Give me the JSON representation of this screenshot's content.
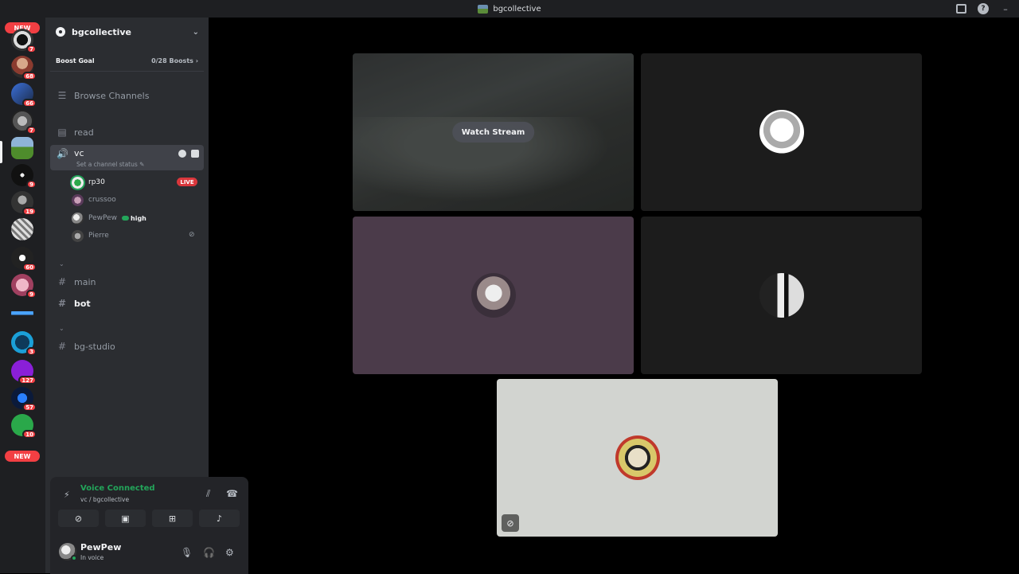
{
  "window": {
    "title": "bgcollective"
  },
  "rail": {
    "new_label_top": "NEW",
    "new_label_bottom": "NEW",
    "servers": [
      {
        "badge": "7"
      },
      {
        "badge": "68"
      },
      {
        "badge": "66"
      },
      {
        "badge": "7"
      },
      {
        "badge": ""
      },
      {
        "badge": "9"
      },
      {
        "badge": "19"
      },
      {
        "badge": ""
      },
      {
        "badge": "60"
      },
      {
        "badge": "9"
      },
      {
        "badge": ""
      },
      {
        "badge": "3"
      },
      {
        "badge": "127"
      },
      {
        "badge": "57"
      },
      {
        "badge": "10"
      }
    ]
  },
  "guild": {
    "name": "bgcollective"
  },
  "boost": {
    "label": "Boost Goal",
    "count": "0/28 Boosts ›"
  },
  "channels": {
    "browse": "Browse Channels",
    "read": "read",
    "vc": "vc",
    "vc_status": "Set a channel status ✎",
    "main": "main",
    "bot": "bot",
    "bg_studio": "bg-studio"
  },
  "voice_users": [
    {
      "name": "rp30",
      "tag": "LIVE"
    },
    {
      "name": "crussoo"
    },
    {
      "name": "PewPew",
      "tag": "high"
    },
    {
      "name": "Pierre"
    }
  ],
  "voice_panel": {
    "status": "Voice Connected",
    "location": "vc / bgcollective"
  },
  "user_panel": {
    "name": "PewPew",
    "status": "In voice"
  },
  "stage": {
    "watch_label": "Watch Stream"
  }
}
